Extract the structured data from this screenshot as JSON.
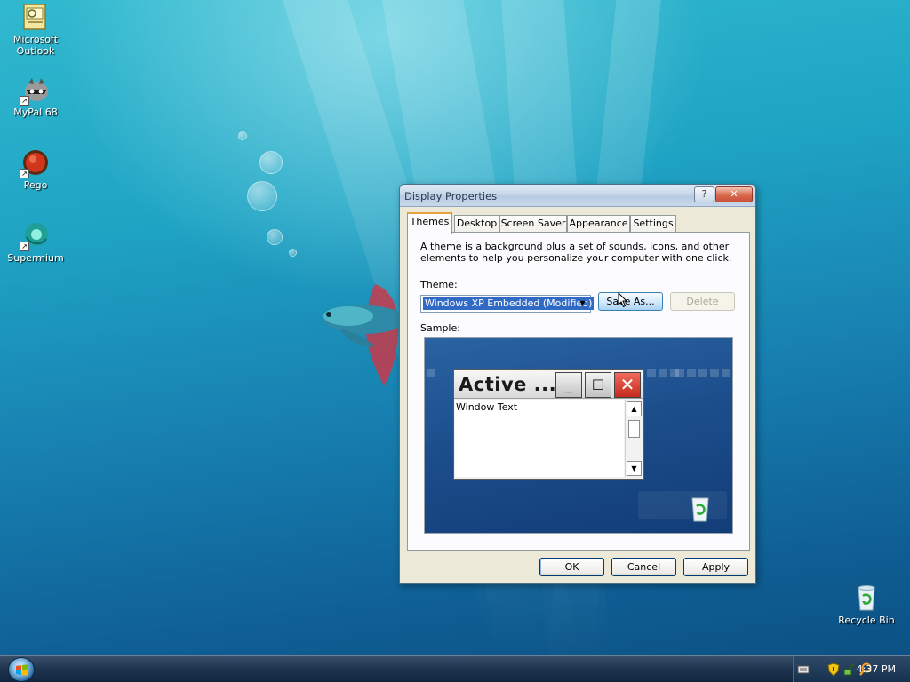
{
  "desktop": {
    "icons": [
      {
        "label": "Microsoft\nOutlook",
        "icon": "outlook-icon"
      },
      {
        "label": "MyPal 68",
        "icon": "mypal-raccoon-icon"
      },
      {
        "label": "Pego",
        "icon": "pego-icon"
      },
      {
        "label": "Supermium",
        "icon": "supermium-icon"
      },
      {
        "label": "Recycle Bin",
        "icon": "recycle-bin-icon"
      }
    ]
  },
  "dialog": {
    "title": "Display Properties",
    "help_label": "?",
    "close_label": "✕",
    "tabs": [
      "Themes",
      "Desktop",
      "Screen Saver",
      "Appearance",
      "Settings"
    ],
    "active_tab": "Themes",
    "description": "A theme is a background plus a set of sounds, icons, and other elements to help you personalize your computer with one click.",
    "theme_label": "Theme:",
    "theme_value": "Windows XP Embedded (Modified)",
    "save_as_label": "Save As...",
    "delete_label": "Delete",
    "sample_label": "Sample:",
    "sample": {
      "window_title": "Active ...",
      "window_text": "Window Text"
    },
    "ok_label": "OK",
    "cancel_label": "Cancel",
    "apply_label": "Apply"
  },
  "taskbar": {
    "clock": "4:37 PM",
    "tray_icons": [
      "keyboard-icon",
      "security-shield-icon",
      "network-icon",
      "search-icon"
    ]
  },
  "colors": {
    "selection": "#316ac5",
    "close_button": "#d96a4c",
    "active_tab_accent": "#e6a23c"
  }
}
